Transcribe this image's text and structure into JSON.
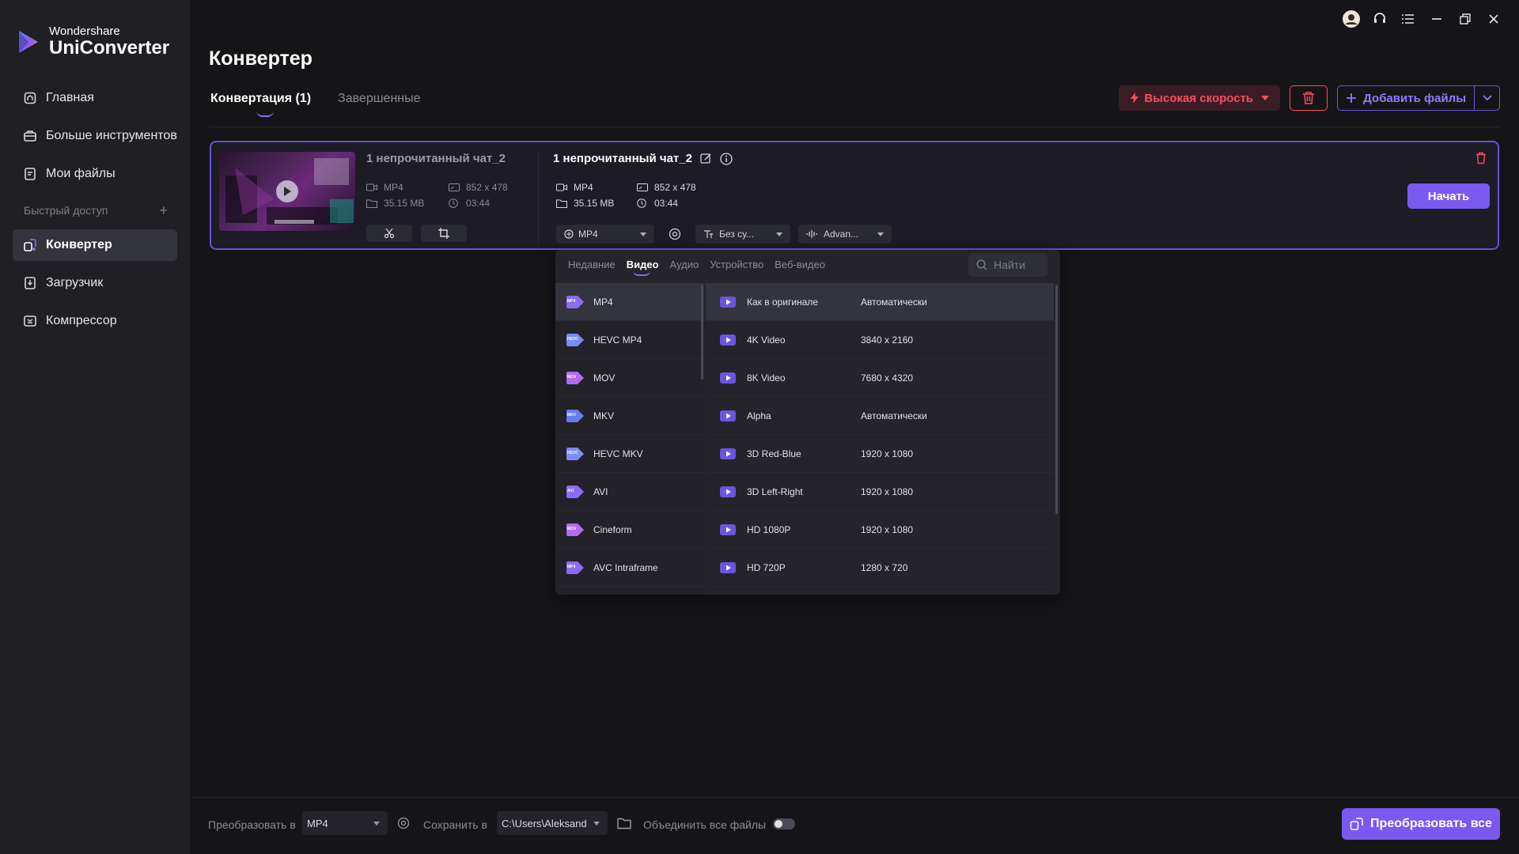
{
  "app": {
    "brand_top": "Wondershare",
    "brand_name": "UniConverter",
    "accent": "#7b58f0",
    "danger": "#ff4a5f"
  },
  "sidebar": {
    "items": [
      {
        "label": "Главная",
        "icon": "home-icon"
      },
      {
        "label": "Больше инструментов",
        "icon": "toolbox-icon"
      },
      {
        "label": "Мои файлы",
        "icon": "files-icon"
      }
    ],
    "quick_access_label": "Быстрый доступ",
    "quick_items": [
      {
        "label": "Конвертер",
        "icon": "converter-icon",
        "active": true
      },
      {
        "label": "Загрузчик",
        "icon": "downloader-icon"
      },
      {
        "label": "Компрессор",
        "icon": "compressor-icon"
      }
    ]
  },
  "window_icons": [
    "account-icon",
    "support-headset-icon",
    "menu-icon",
    "minimize-icon",
    "restore-icon",
    "close-icon"
  ],
  "main": {
    "title": "Конвертер",
    "tabs": [
      {
        "label": "Конвертация (1)",
        "active": true
      },
      {
        "label": "Завершенные",
        "active": false
      }
    ],
    "speed_button": "Высокая скорость",
    "add_files_button": "Добавить файлы"
  },
  "file": {
    "source_name": "1 непрочитанный чат_2",
    "source_format": "MP4",
    "source_resolution": "852 x 478",
    "source_size": "35.15 MB",
    "source_duration": "03:44",
    "output_name": "1 непрочитанный чат_2",
    "output_format": "MP4",
    "output_resolution": "852 x 478",
    "output_size": "35.15 MB",
    "output_duration": "03:44",
    "format_select": "MP4",
    "subtitle_select": "Без су...",
    "audio_select": "Advan...",
    "start_button": "Начать"
  },
  "format_panel": {
    "tabs": [
      {
        "label": "Недавние",
        "active": false
      },
      {
        "label": "Видео",
        "active": true
      },
      {
        "label": "Аудио",
        "active": false
      },
      {
        "label": "Устройство",
        "active": false
      },
      {
        "label": "Веб-видео",
        "active": false
      }
    ],
    "search_placeholder": "Найти",
    "formats": [
      {
        "label": "MP4",
        "badge": "MP4",
        "selected": true
      },
      {
        "label": "HEVC MP4",
        "badge": "HEVC"
      },
      {
        "label": "MOV",
        "badge": "MOV"
      },
      {
        "label": "MKV",
        "badge": "MKV"
      },
      {
        "label": "HEVC MKV",
        "badge": "HEVC"
      },
      {
        "label": "AVI",
        "badge": "AVI"
      },
      {
        "label": "Cineform",
        "badge": "MOV"
      },
      {
        "label": "AVC Intraframe",
        "badge": "MP4"
      }
    ],
    "qualities": [
      {
        "name": "Как в оригинале",
        "res": "Автоматически",
        "selected": true
      },
      {
        "name": "4K Video",
        "res": "3840 x 2160"
      },
      {
        "name": "8K Video",
        "res": "7680 x 4320"
      },
      {
        "name": "Alpha",
        "res": "Автоматически"
      },
      {
        "name": "3D Red-Blue",
        "res": "1920 x 1080"
      },
      {
        "name": "3D Left-Right",
        "res": "1920 x 1080"
      },
      {
        "name": "HD 1080P",
        "res": "1920 x 1080"
      },
      {
        "name": "HD 720P",
        "res": "1280 x 720"
      }
    ]
  },
  "bottom": {
    "convert_to_label": "Преобразовать в",
    "convert_to_value": "MP4",
    "save_to_label": "Сохранить в",
    "save_to_value": "C:\\Users\\Aleksand",
    "merge_label": "Объединить все файлы",
    "merge_enabled": false,
    "convert_all_button": "Преобразовать все"
  }
}
